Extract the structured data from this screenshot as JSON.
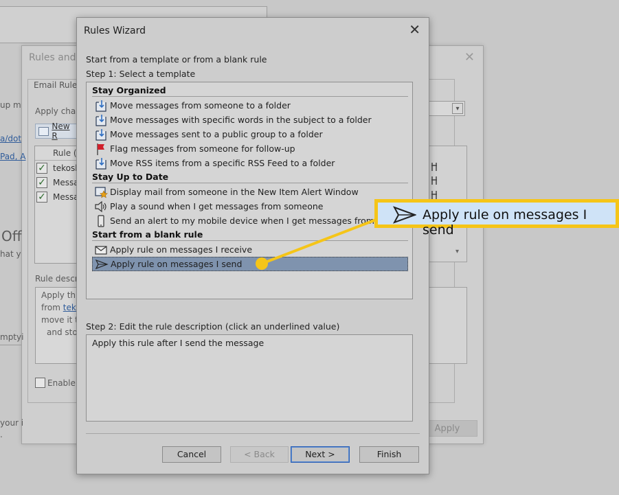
{
  "background": {
    "window_title": "Rules and A",
    "tab_label": "Email Rules",
    "frag_up": "up m",
    "frag_apply_change": "Apply char",
    "link_1": "a/dot",
    "link_2": "Pad, A",
    "new_rule_partial": "New R",
    "list_header": "Rule (",
    "list_items": [
      "tekosh",
      "Messa",
      "Messa"
    ],
    "frag_off": "Off",
    "frag_that": "hat y",
    "rule_desc_label": "Rule descr",
    "desc_lines": [
      "Apply thi",
      "from ",
      "move it t",
      "and stor"
    ],
    "desc_link": "teko",
    "frag_empty": "mptyi",
    "enable_label": "Enable",
    "frag_your": "your i",
    "frag_dot": ".",
    "apply_button": "Apply"
  },
  "dialog": {
    "title": "Rules Wizard",
    "intro": "Start from a template or from a blank rule",
    "step1": "Step 1: Select a template",
    "groups": [
      {
        "name": "Stay Organized",
        "items": [
          {
            "label": "Move messages from someone to a folder",
            "icon": "folder-move-icon"
          },
          {
            "label": "Move messages with specific words in the subject to a folder",
            "icon": "folder-move-icon"
          },
          {
            "label": "Move messages sent to a public group to a folder",
            "icon": "folder-move-icon"
          },
          {
            "label": "Flag messages from someone for follow-up",
            "icon": "flag-icon"
          },
          {
            "label": "Move RSS items from a specific RSS Feed to a folder",
            "icon": "folder-move-icon"
          }
        ]
      },
      {
        "name": "Stay Up to Date",
        "items": [
          {
            "label": "Display mail from someone in the New Item Alert Window",
            "icon": "alert-star-icon"
          },
          {
            "label": "Play a sound when I get messages from someone",
            "icon": "speaker-icon"
          },
          {
            "label": "Send an alert to my mobile device when I get messages from s",
            "icon": "mobile-icon"
          }
        ]
      },
      {
        "name": "Start from a blank rule",
        "items": [
          {
            "label": "Apply rule on messages I receive",
            "icon": "envelope-icon"
          },
          {
            "label": "Apply rule on messages I send",
            "icon": "send-icon",
            "selected": true
          }
        ]
      }
    ],
    "step2": "Step 2: Edit the rule description (click an underlined value)",
    "description": "Apply this rule after I send the message",
    "buttons": {
      "cancel": "Cancel",
      "back": "< Back",
      "next": "Next >",
      "finish": "Finish"
    }
  },
  "callout": {
    "text": "Apply rule on messages I send",
    "icon": "send-icon",
    "border_color": "#f5c518",
    "fill_color": "#cfe3f7"
  },
  "colors": {
    "selection": "#7f93ae",
    "highlight": "#f5c518"
  }
}
